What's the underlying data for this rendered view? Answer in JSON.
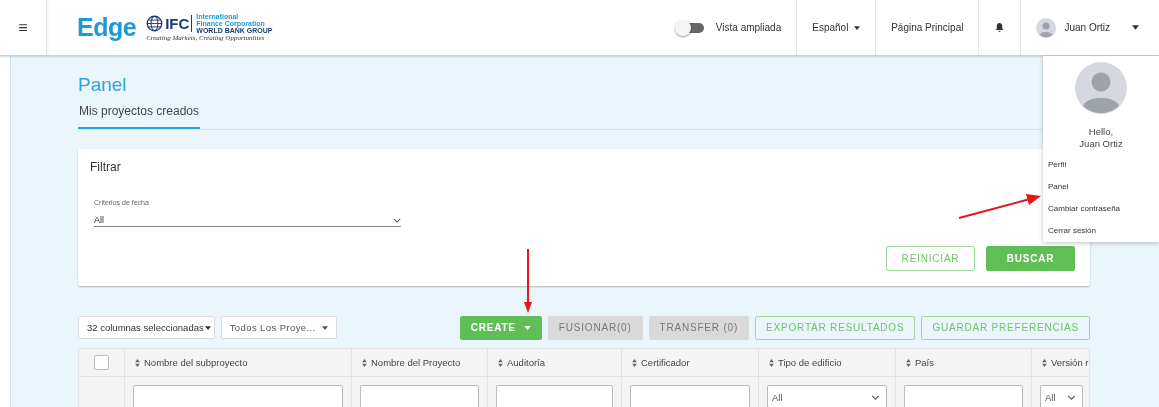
{
  "header": {
    "menu_glyph": "≡",
    "brand": "Edge",
    "partner": {
      "name": "IFC",
      "line1": "International",
      "line2": "Finance Corporation",
      "group": "WORLD BANK GROUP",
      "tagline": "Creating Markets, Creating Opportunities"
    },
    "toggle": {
      "label": "Vista ampliada",
      "on": false
    },
    "language": "Español",
    "home_link": "Página Principal",
    "user": "Juan Ortiz"
  },
  "user_menu": {
    "greeting": "Hello,",
    "name": "Juan Ortiz",
    "items": [
      {
        "label": "Perfil"
      },
      {
        "label": "Panel"
      },
      {
        "label": "Cambiar contraseña"
      },
      {
        "label": "Cerrar sesión"
      }
    ]
  },
  "page": {
    "title": "Panel",
    "tabs": [
      {
        "label": "Mis proyectos creados",
        "selected": true
      }
    ]
  },
  "filter": {
    "title": "Filtrar",
    "field_label": "Criterios de fecha",
    "field_value": "All",
    "buttons": [
      {
        "label": "REINICIAR",
        "kind": "outline"
      },
      {
        "label": "BUSCAR",
        "kind": "solid"
      }
    ]
  },
  "toolbar": {
    "columns_select": "32 columnas seleccionadas",
    "projects_select": "Todos Los Proye...",
    "buttons": [
      {
        "label": "CREATE",
        "kind": "solid",
        "caret": true
      },
      {
        "label": "FUSIONAR(0)",
        "kind": "disabled",
        "caret": false
      },
      {
        "label": "TRANSFER (0)",
        "kind": "disabled",
        "caret": false
      },
      {
        "label": "EXPORTAR RESULTADOS",
        "kind": "outline",
        "caret": false
      },
      {
        "label": "GUARDAR PREFERENCIAS",
        "kind": "outline",
        "caret": false
      }
    ]
  },
  "table": {
    "select_all_checked": false,
    "columns": [
      {
        "label": "Nombre del subproyecto",
        "kind": "text"
      },
      {
        "label": "Nombre del Proyecto",
        "kind": "text"
      },
      {
        "label": "Auditoría",
        "kind": "text"
      },
      {
        "label": "Certificador",
        "kind": "text"
      },
      {
        "label": "Tipo de edificio",
        "kind": "select",
        "value": "All"
      },
      {
        "label": "País",
        "kind": "text"
      },
      {
        "label": "Versión r",
        "kind": "select",
        "value": "All"
      }
    ]
  }
}
